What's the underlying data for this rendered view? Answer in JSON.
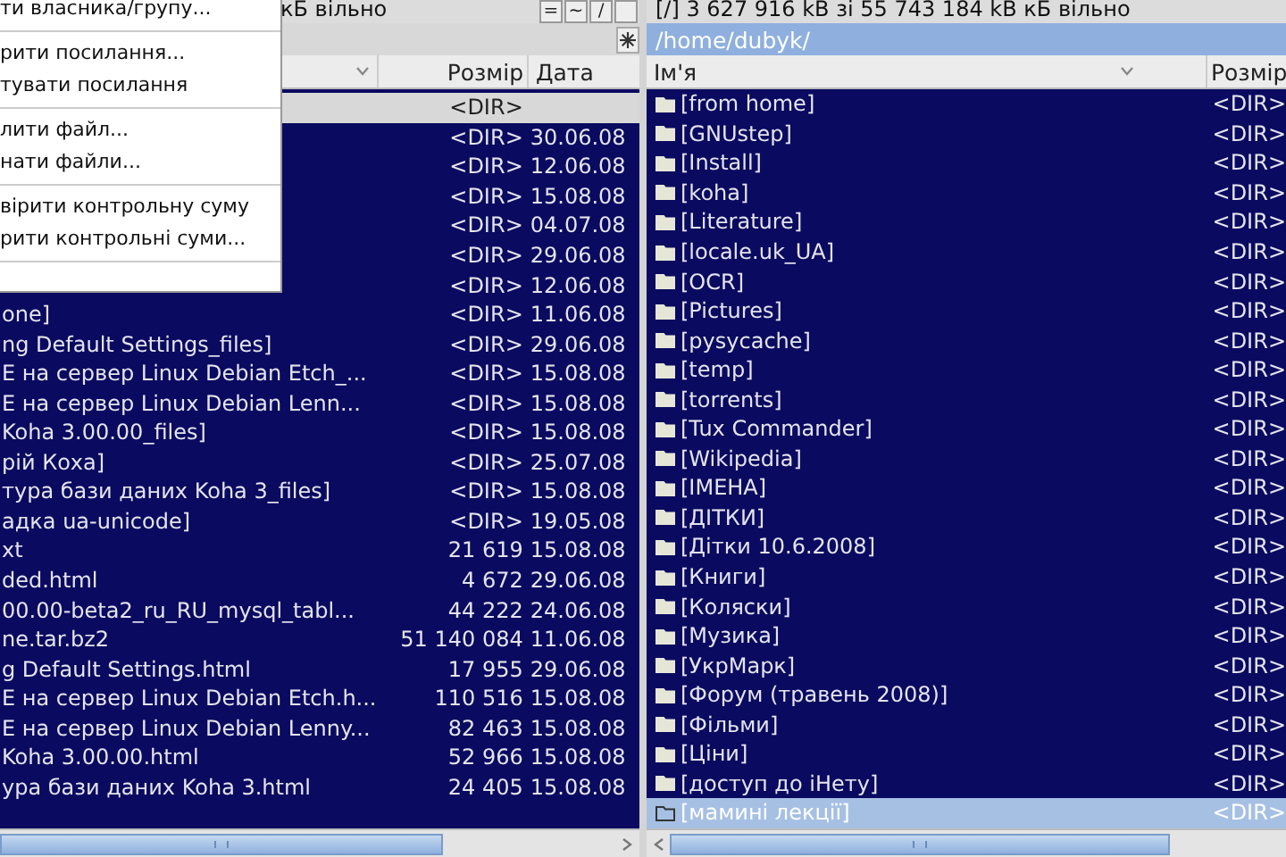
{
  "context_menu": {
    "items": [
      {
        "kind": "item",
        "label": "ти власника/групу..."
      },
      {
        "kind": "separator"
      },
      {
        "kind": "item",
        "label": "рити посилання..."
      },
      {
        "kind": "item",
        "label": "тувати посилання"
      },
      {
        "kind": "separator"
      },
      {
        "kind": "item",
        "label": "лити файл..."
      },
      {
        "kind": "item",
        "label": "нати файли..."
      },
      {
        "kind": "separator"
      },
      {
        "kind": "item",
        "label": "вірити контрольну суму"
      },
      {
        "kind": "item",
        "label": "рити контрольні суми..."
      },
      {
        "kind": "separator"
      }
    ]
  },
  "left_panel": {
    "disk_info": "кБ вільно",
    "drive_buttons": [
      "=",
      "~",
      "/"
    ],
    "columns": [
      "Розмір",
      "Дата"
    ],
    "rows": [
      {
        "size": "<DIR>",
        "selected": true
      },
      {
        "size": "<DIR>",
        "date": "30.06.08",
        "selected": false
      },
      {
        "size": "<DIR>",
        "date": "12.06.08",
        "selected": false
      },
      {
        "size": "<DIR>",
        "date": "15.08.08",
        "selected": false
      },
      {
        "size": "<DIR>",
        "date": "04.07.08",
        "selected": false
      },
      {
        "size": "<DIR>",
        "date": "29.06.08",
        "selected": false
      },
      {
        "size": "<DIR>",
        "date": "12.06.08",
        "selected": false
      },
      {
        "name": "one]",
        "size": "<DIR>",
        "date": "11.06.08",
        "selected": false
      },
      {
        "name": "ng Default Settings_files]",
        "size": "<DIR>",
        "date": "29.06.08",
        "selected": false
      },
      {
        "name": "E на сервер Linux Debian Etch_...",
        "size": "<DIR>",
        "date": "15.08.08",
        "selected": false
      },
      {
        "name": "E на сервер Linux Debian Lenn...",
        "size": "<DIR>",
        "date": "15.08.08",
        "selected": false
      },
      {
        "name": "Koha 3.00.00_files]",
        "size": "<DIR>",
        "date": "15.08.08",
        "selected": false
      },
      {
        "name": "рій Коха]",
        "size": "<DIR>",
        "date": "25.07.08",
        "selected": false
      },
      {
        "name": "тура бази даних Koha 3_files]",
        "size": "<DIR>",
        "date": "15.08.08",
        "selected": false
      },
      {
        "name": "адка ua-unicode]",
        "size": "<DIR>",
        "date": "19.05.08",
        "selected": false
      },
      {
        "name": "xt",
        "size": "21 619",
        "date": "15.08.08",
        "selected": false
      },
      {
        "name": "ded.html",
        "size": "4 672",
        "date": "29.06.08",
        "selected": false
      },
      {
        "name": "00.00-beta2_ru_RU_mysql_tabl...",
        "size": "44 222",
        "date": "24.06.08",
        "selected": false
      },
      {
        "name": "ne.tar.bz2",
        "size": "51 140 084",
        "date": "11.06.08",
        "selected": false
      },
      {
        "name": "g Default Settings.html",
        "size": "17 955",
        "date": "29.06.08",
        "selected": false
      },
      {
        "name": "E на сервер Linux Debian Etch.h...",
        "size": "110 516",
        "date": "15.08.08",
        "selected": false
      },
      {
        "name": "E на сервер Linux Debian Lenny...",
        "size": "82 463",
        "date": "15.08.08",
        "selected": false
      },
      {
        "name": "Koha 3.00.00.html",
        "size": "52 966",
        "date": "15.08.08",
        "selected": false
      },
      {
        "name": "ура бази даних Koha 3.html",
        "size": "24 405",
        "date": "15.08.08",
        "selected": false
      }
    ]
  },
  "right_panel": {
    "disk_info": "[/] 3 627 916 kB зі 55 743 184 kB кБ вільно",
    "path": "/home/dubyk/",
    "columns": [
      "Ім'я",
      "Розмір"
    ],
    "rows": [
      {
        "name": "[from home]",
        "size": "<DIR>",
        "selected": false
      },
      {
        "name": "[GNUstep]",
        "size": "<DIR>",
        "selected": false
      },
      {
        "name": "[Install]",
        "size": "<DIR>",
        "selected": false
      },
      {
        "name": "[koha]",
        "size": "<DIR>",
        "selected": false
      },
      {
        "name": "[Literature]",
        "size": "<DIR>",
        "selected": false
      },
      {
        "name": "[locale.uk_UA]",
        "size": "<DIR>",
        "selected": false
      },
      {
        "name": "[OCR]",
        "size": "<DIR>",
        "selected": false
      },
      {
        "name": "[Pictures]",
        "size": "<DIR>",
        "selected": false
      },
      {
        "name": "[pysycache]",
        "size": "<DIR>",
        "selected": false
      },
      {
        "name": "[temp]",
        "size": "<DIR>",
        "selected": false
      },
      {
        "name": "[torrents]",
        "size": "<DIR>",
        "selected": false
      },
      {
        "name": "[Tux Commander]",
        "size": "<DIR>",
        "selected": false
      },
      {
        "name": "[Wikipedia]",
        "size": "<DIR>",
        "selected": false
      },
      {
        "name": "[ІМЕНА]",
        "size": "<DIR>",
        "selected": false
      },
      {
        "name": "[ДІТКИ]",
        "size": "<DIR>",
        "selected": false
      },
      {
        "name": "[Дітки 10.6.2008]",
        "size": "<DIR>",
        "selected": false
      },
      {
        "name": "[Книги]",
        "size": "<DIR>",
        "selected": false
      },
      {
        "name": "[Коляски]",
        "size": "<DIR>",
        "selected": false
      },
      {
        "name": "[Музика]",
        "size": "<DIR>",
        "selected": false
      },
      {
        "name": "[УкрМарк]",
        "size": "<DIR>",
        "selected": false
      },
      {
        "name": "[Форум (травень 2008)]",
        "size": "<DIR>",
        "selected": false
      },
      {
        "name": "[Фільми]",
        "size": "<DIR>",
        "selected": false
      },
      {
        "name": "[Ціни]",
        "size": "<DIR>",
        "selected": false
      },
      {
        "name": "[доступ до іНету]",
        "size": "<DIR>",
        "selected": false
      },
      {
        "name": "[мамині лекції]",
        "size": "<DIR>",
        "selected": true
      }
    ]
  }
}
